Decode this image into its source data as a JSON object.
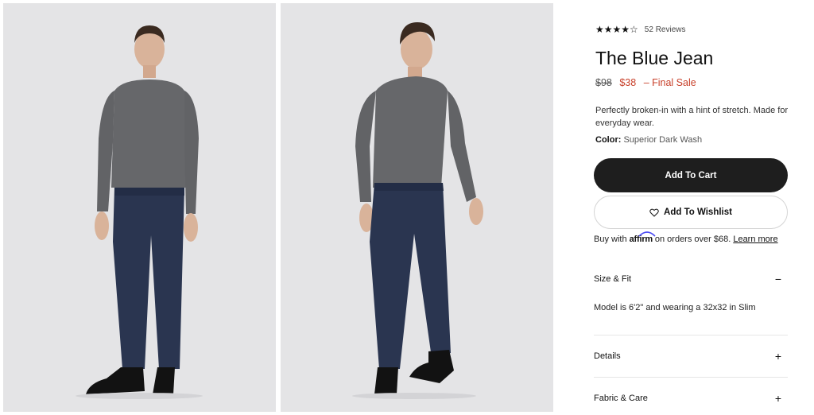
{
  "product": {
    "rating_stars": "★★★★☆",
    "reviews_label": "52 Reviews",
    "title": "The Blue Jean",
    "price_original": "$98",
    "price_sale": "$38",
    "price_note": "–  Final Sale",
    "description": "Perfectly broken-in with a hint of stretch. Made for everyday wear.",
    "color_label": "Color:",
    "color_value": "Superior Dark Wash"
  },
  "actions": {
    "add_to_cart": "Add To Cart",
    "add_to_wishlist": "Add To Wishlist"
  },
  "affirm": {
    "prefix": "Buy with",
    "logo_text": "affirm",
    "suffix": "on orders over $68.",
    "link": "Learn more"
  },
  "accordion": [
    {
      "label": "Size & Fit",
      "sign": "−",
      "content": "Model is 6'2\" and wearing a 32x32 in Slim"
    },
    {
      "label": "Details",
      "sign": "+"
    },
    {
      "label": "Fabric & Care",
      "sign": "+"
    }
  ],
  "colors": {
    "sale": "#c8402a",
    "button_dark": "#1e1e1e",
    "photo_bg": "#e4e4e6",
    "affirm_accent": "#4a4af4"
  }
}
